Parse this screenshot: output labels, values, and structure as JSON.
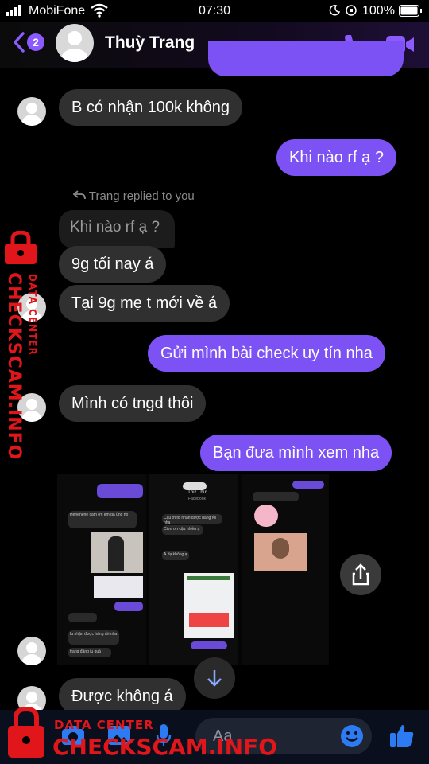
{
  "status": {
    "carrier": "MobiFone",
    "time": "07:30",
    "battery": "100%"
  },
  "header": {
    "unread_count": "2",
    "contact_name": "Thuỳ Trang"
  },
  "messages": {
    "m1": "B có nhận 100k không",
    "m2": "Khi nào rf ạ ?",
    "reply_hint": "Trang replied to you",
    "quoted": "Khi nào rf ạ ?",
    "m3": "9g tối nay á",
    "m4": "Tại 9g mẹ t mới về á",
    "m5": "Gửi mình bài check uy tín nha",
    "m6": "Mình có tngd thôi",
    "m7": "Bạn đưa mình xem nha",
    "m8": "Được không á"
  },
  "image_preview": {
    "name1": "Thư Thư",
    "sub1": "Facebook",
    "lines": [
      "Hehehehe cảm ơn em đã ủng hộ",
      "Cậu ơi tớ nhận được hàng rồi nha",
      "Cảm ơn cậu nhiều ạ",
      "Á dạ không ạ",
      "Dạ dạ cảm ơn ạ",
      "Iu nhận được hàng rồi nha",
      "trang đáng iu quá"
    ]
  },
  "composer": {
    "placeholder": "Aa"
  },
  "watermark": {
    "small": "DATA CENTER",
    "big": "CHECKSCAM.INFO"
  },
  "colors": {
    "accent": "#8c5bff",
    "outgoing_bubble": "#7d52f4",
    "incoming_bubble": "#303030",
    "watermark": "#e0161b"
  }
}
